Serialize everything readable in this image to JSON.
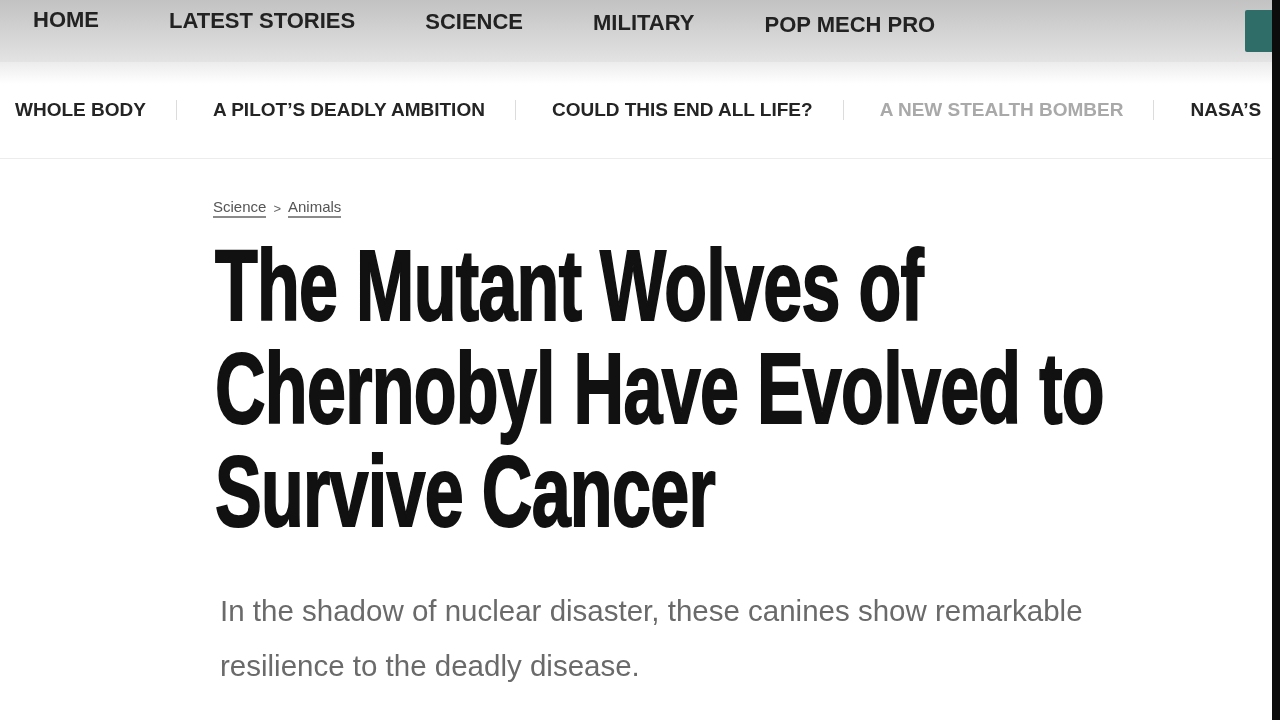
{
  "top_nav": {
    "links": [
      "HOME",
      "LATEST STORIES",
      "SCIENCE",
      "MILITARY",
      "POP MECH PRO"
    ]
  },
  "trending": [
    {
      "label": "WHOLE BODY",
      "dimmed": false
    },
    {
      "label": "A PILOT’S DEADLY AMBITION",
      "dimmed": false
    },
    {
      "label": "COULD THIS END ALL LIFE?",
      "dimmed": false
    },
    {
      "label": "A NEW STEALTH BOMBER",
      "dimmed": true
    },
    {
      "label": "NASA’S",
      "dimmed": false
    }
  ],
  "article": {
    "breadcrumb": {
      "items": [
        "Science",
        "Animals"
      ],
      "separator": ">"
    },
    "title": "The Mutant Wolves of Chernobyl Have Evolved to Survive Cancer",
    "dek": "In the shadow of nuclear disaster, these canines show remarkable resilience to the deadly disease."
  }
}
